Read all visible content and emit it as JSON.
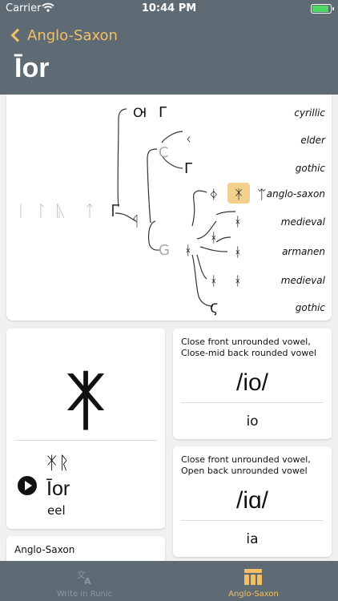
{
  "status": {
    "carrier": "Carrier",
    "time": "10:44 PM"
  },
  "nav": {
    "back_label": "Anglo-Saxon",
    "title": "Īor"
  },
  "tree": {
    "lineage_glyphs": [
      "ᛁ",
      "ᛚ",
      "ᚣ",
      "ᛏ",
      "Γ",
      "ᛩ"
    ],
    "cyrillic": {
      "glyphs": [
        "Ꙕ",
        "Γ"
      ],
      "label": "cyrillic"
    },
    "elder": {
      "group": "C",
      "glyph": "ᚲ",
      "label": "elder"
    },
    "gothic_top": {
      "glyph": "Γ",
      "label": "gothic"
    },
    "anglo_saxon": {
      "glyphs": [
        "ᛄ",
        "ᛡ",
        "ᛠ"
      ],
      "label": "anglo-saxon",
      "highlight": "#f2d08c"
    },
    "g_group": "G",
    "medieval_1": {
      "glyph": "ᚼ",
      "label": "medieval"
    },
    "split_glyph": "ᚼ",
    "armanen": {
      "glyph": "ᚼ",
      "label": "armanen"
    },
    "medieval_2": {
      "glyphs": [
        "ᚼ",
        "ᚼ"
      ],
      "label": "medieval"
    },
    "gothic_bottom": {
      "glyph": "Ϛ",
      "label": "gothic"
    },
    "c_bridge": "ᛩ"
  },
  "rune": {
    "glyph": "ᛡ",
    "word_runes": "ᛡᚱ",
    "word_latin": "Īor",
    "meaning": "eel"
  },
  "sounds": [
    {
      "desc": "Close front unrounded vowel, Close-mid back rounded vowel",
      "ipa": "/io/",
      "translit": "io"
    },
    {
      "desc": "Close front unrounded vowel, Open back unrounded vowel",
      "ipa": "/iɑ/",
      "translit": "ia"
    }
  ],
  "language_card": "Anglo-Saxon",
  "tabs": [
    {
      "label": "Write in Runic",
      "icon": "translate-icon",
      "active": false
    },
    {
      "label": "Anglo-Saxon",
      "icon": "table-icon",
      "active": true
    }
  ],
  "colors": {
    "header": "#5e6b75",
    "accent": "#f2c063",
    "highlight": "#f2d08c"
  }
}
